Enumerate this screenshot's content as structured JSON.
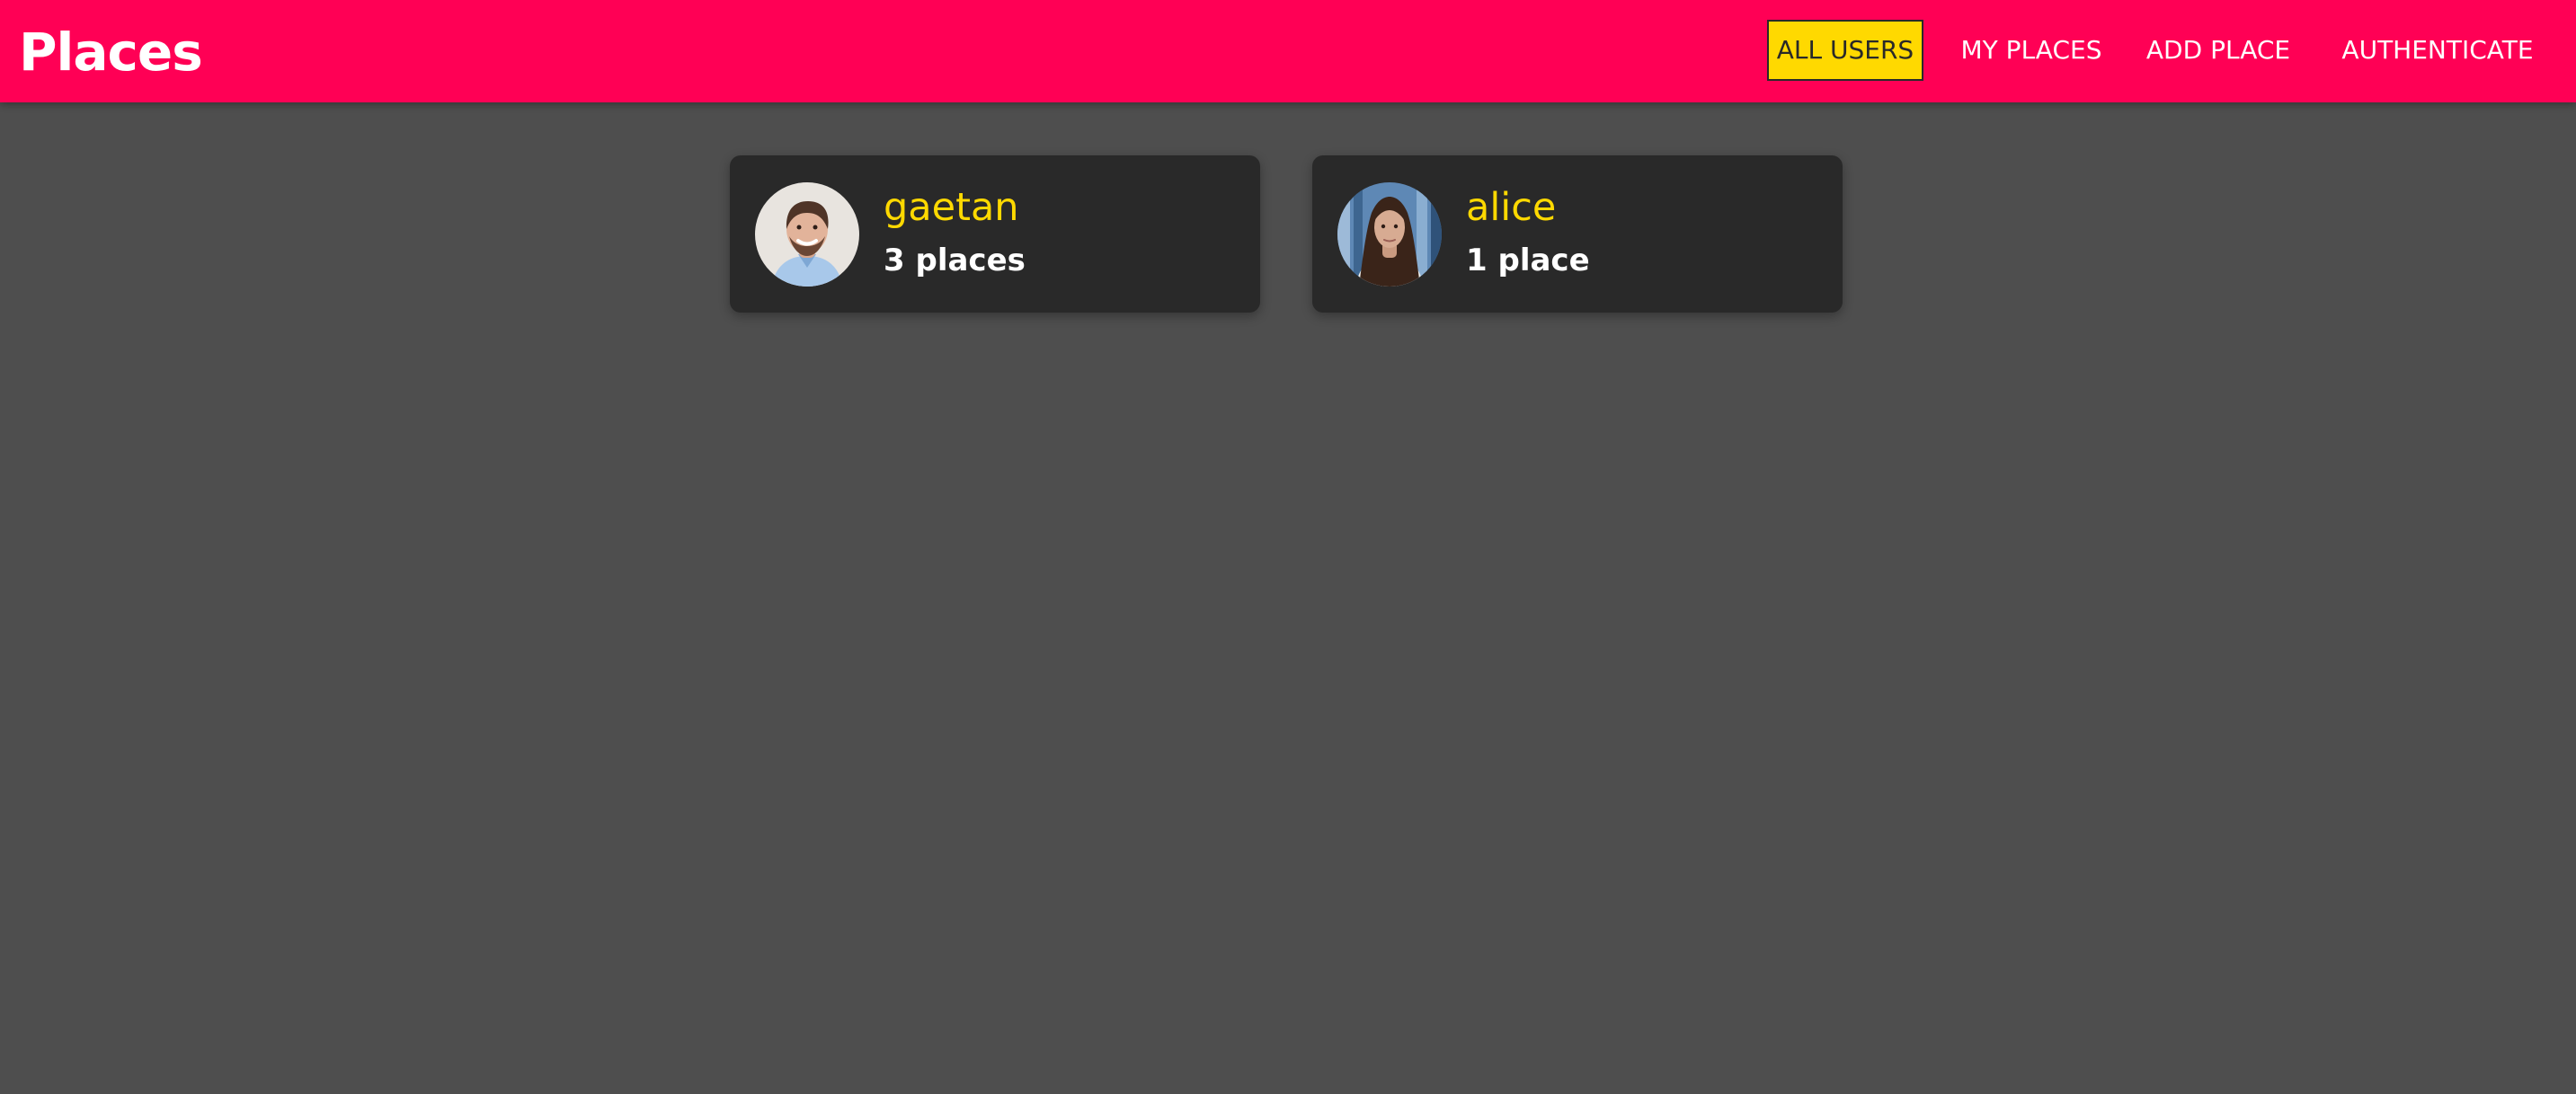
{
  "header": {
    "title": "Places",
    "nav": [
      {
        "label": "ALL USERS",
        "active": true
      },
      {
        "label": "MY PLACES",
        "active": false
      },
      {
        "label": "ADD PLACE",
        "active": false
      },
      {
        "label": "AUTHENTICATE",
        "active": false
      }
    ]
  },
  "users": [
    {
      "name": "gaetan",
      "places": "3 places",
      "avatar": "user-photo-man"
    },
    {
      "name": "alice",
      "places": "1 place",
      "avatar": "user-photo-woman"
    }
  ],
  "colors": {
    "header_bg": "#ff0055",
    "page_bg": "#4e4e4e",
    "card_bg": "#292929",
    "accent": "#ffd900",
    "text": "#ffffff"
  }
}
